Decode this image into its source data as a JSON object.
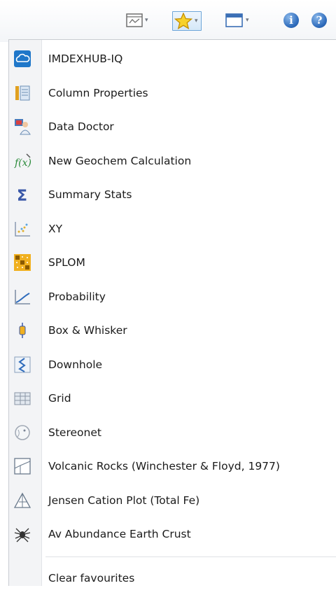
{
  "toolbar": {
    "buttons": [
      {
        "name": "chart-window-icon",
        "has_dropdown": true
      },
      {
        "name": "star-icon",
        "has_dropdown": true,
        "active": true
      },
      {
        "name": "window-icon",
        "has_dropdown": true
      },
      {
        "name": "info-icon",
        "glyph": "i"
      },
      {
        "name": "help-icon",
        "glyph": "?"
      }
    ],
    "dropdown_arrow": "▾"
  },
  "menu": {
    "items": [
      {
        "label": "IMDEXHUB-IQ",
        "icon": "cloud-icon"
      },
      {
        "label": "Column Properties",
        "icon": "column-properties-icon"
      },
      {
        "label": "Data Doctor",
        "icon": "data-doctor-icon"
      },
      {
        "label": "New Geochem Calculation",
        "icon": "function-icon"
      },
      {
        "label": "Summary Stats",
        "icon": "sigma-icon"
      },
      {
        "label": "XY",
        "icon": "xy-plot-icon"
      },
      {
        "label": "SPLOM",
        "icon": "splom-icon"
      },
      {
        "label": "Probability",
        "icon": "probability-icon"
      },
      {
        "label": "Box & Whisker",
        "icon": "box-whisker-icon"
      },
      {
        "label": "Downhole",
        "icon": "downhole-icon"
      },
      {
        "label": "Grid",
        "icon": "grid-icon"
      },
      {
        "label": "Stereonet",
        "icon": "stereonet-icon"
      },
      {
        "label": "Volcanic Rocks (Winchester & Floyd, 1977)",
        "icon": "volcanic-rocks-icon"
      },
      {
        "label": "Jensen Cation Plot (Total Fe)",
        "icon": "jensen-plot-icon"
      },
      {
        "label": "Av Abundance Earth Crust",
        "icon": "spider-icon"
      }
    ],
    "clear_label": "Clear favourites"
  }
}
